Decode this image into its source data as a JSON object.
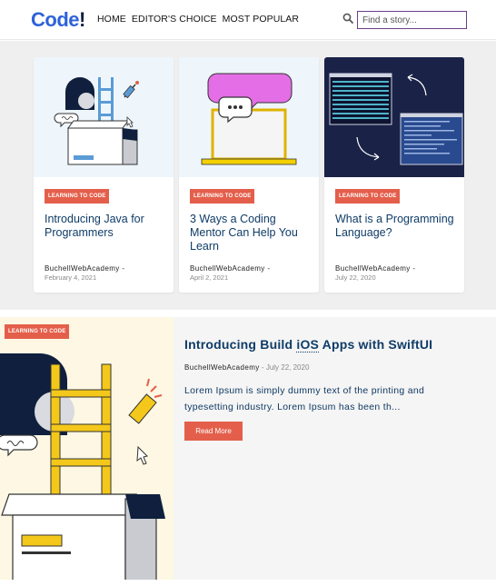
{
  "header": {
    "logo_text": "Code",
    "logo_bang": "!",
    "nav": [
      "HOME",
      "EDITOR'S CHOICE",
      "MOST POPULAR"
    ],
    "search_placeholder": "Find a story...",
    "search_icon": "search-icon"
  },
  "cards": [
    {
      "tag": "LEARNING TO CODE",
      "title": "Introducing Java for Programmers",
      "author": "BuchellWebAcademy -",
      "date": "February 4, 2021",
      "thumb_bg": "#eef6fb"
    },
    {
      "tag": "LEARNING TO CODE",
      "title": "3 Ways a Coding Mentor Can Help You Learn",
      "author": "BuchellWebAcademy -",
      "date": "April 2, 2021",
      "thumb_bg": "#eef6fb"
    },
    {
      "tag": "LEARNING TO CODE",
      "title": "What is a Programming Language?",
      "author": "BuchellWebAcademy -",
      "date": "July 22, 2020",
      "thumb_bg": "#1a2247"
    }
  ],
  "featured": {
    "tag": "LEARNING TO CODE",
    "title_pre": "Introducing Build ",
    "title_abbr": "iOS",
    "title_post": " Apps with SwiftUI",
    "author": "BuchellWebAcademy",
    "date_sep": " - ",
    "date": "July 22, 2020",
    "body": "Lorem Ipsum is simply dummy text of the printing and typesetting industry. Lorem Ipsum has been th...",
    "button": "Read More"
  },
  "colors": {
    "brand": "#2e62d9",
    "accent": "#e45f4b",
    "title": "#0f3c67"
  }
}
